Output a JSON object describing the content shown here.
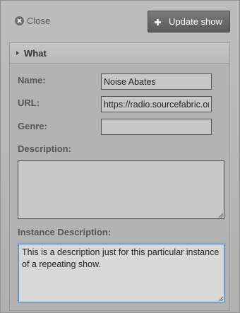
{
  "toolbar": {
    "close_label": "Close",
    "update_label": "Update show"
  },
  "section": {
    "title": "What"
  },
  "form": {
    "name_label": "Name:",
    "name_value": "Noise Abates",
    "url_label": "URL:",
    "url_value": "https://radio.sourcefabric.org",
    "genre_label": "Genre:",
    "genre_value": "",
    "description_label": "Description:",
    "description_value": "",
    "instance_description_label": "Instance Description:",
    "instance_description_value": "This is a description just for this particular instance of a repeating show."
  },
  "icons": {
    "close": "close-circle-icon",
    "add": "plus-icon",
    "expand": "triangle-right-icon",
    "resize": "resize-grip-icon"
  },
  "colors": {
    "focus_border": "#4a8fd0",
    "button_bg": "#666666"
  }
}
